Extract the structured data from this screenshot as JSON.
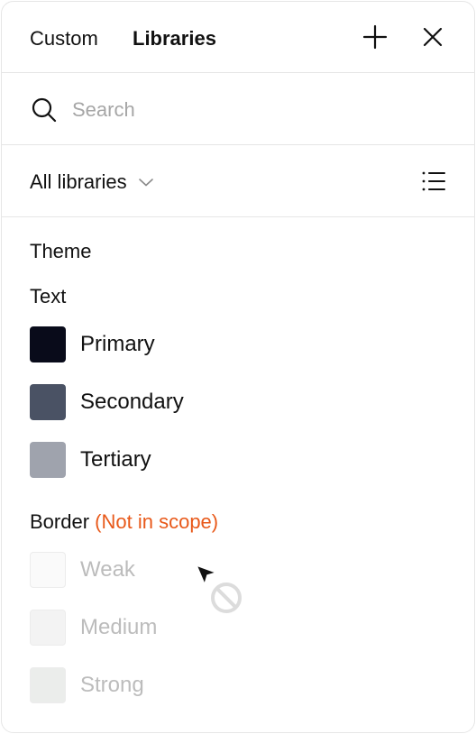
{
  "header": {
    "tabs": [
      {
        "label": "Custom",
        "active": false
      },
      {
        "label": "Libraries",
        "active": true
      }
    ],
    "add_icon": "plus-icon",
    "close_icon": "close-icon"
  },
  "search": {
    "placeholder": "Search",
    "value": "",
    "icon": "search-icon"
  },
  "filter": {
    "library_select": "All libraries",
    "dropdown_icon": "chevron-down-icon",
    "view_icon": "list-view-icon"
  },
  "theme": {
    "heading": "Theme",
    "text_group": {
      "heading": "Text",
      "items": [
        {
          "label": "Primary",
          "color": "#090b1a"
        },
        {
          "label": "Secondary",
          "color": "#4a5264"
        },
        {
          "label": "Tertiary",
          "color": "#9fa3ad"
        }
      ]
    },
    "border_group": {
      "heading": "Border",
      "note": "(Not in scope)",
      "note_color": "#e8591a",
      "items": [
        {
          "label": "Weak",
          "color": "#fafafa"
        },
        {
          "label": "Medium",
          "color": "#f3f3f3"
        },
        {
          "label": "Strong",
          "color": "#ebedeb"
        }
      ]
    }
  },
  "cursor": {
    "icon": "not-allowed-cursor-icon"
  }
}
